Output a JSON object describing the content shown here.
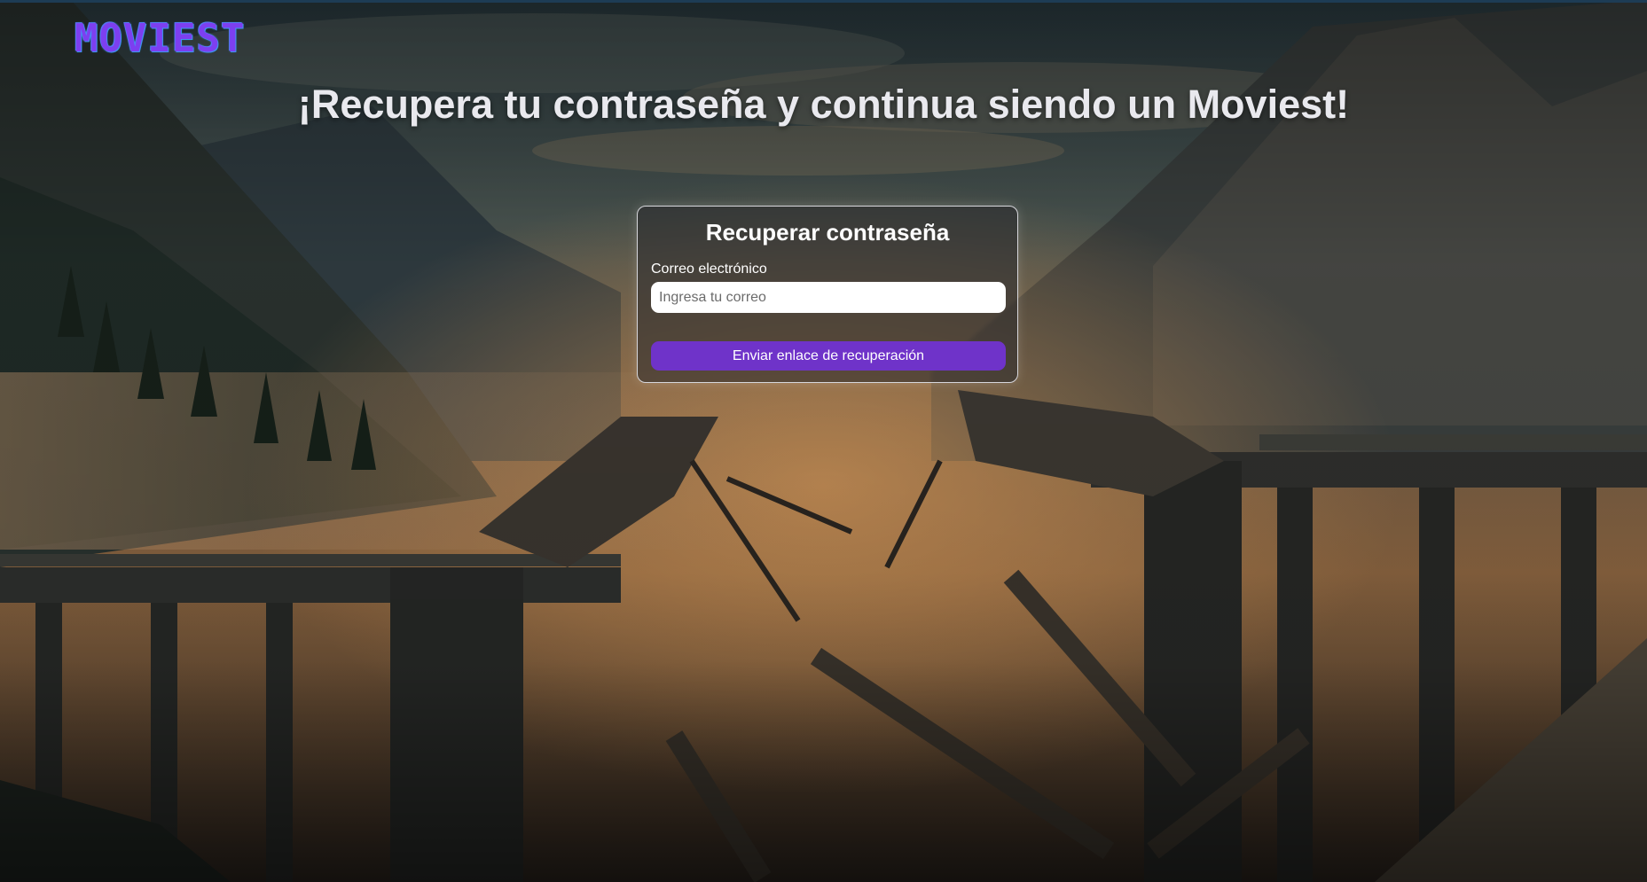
{
  "brand": {
    "logo_text": "MOVIEST",
    "logo_color": "#7d3ff0",
    "logo_outline_color": "#3e8fe8"
  },
  "page": {
    "headline": "¡Recupera tu contraseña y continua siendo un Moviest!",
    "background_image": "collapsed-bridge-mountain-scene"
  },
  "recovery_form": {
    "title": "Recuperar contraseña",
    "email_label": "Correo electrónico",
    "email_value": "",
    "email_placeholder": "Ingresa tu correo",
    "submit_label": "Enviar enlace de recuperación",
    "submit_color": "#6f33c9"
  }
}
